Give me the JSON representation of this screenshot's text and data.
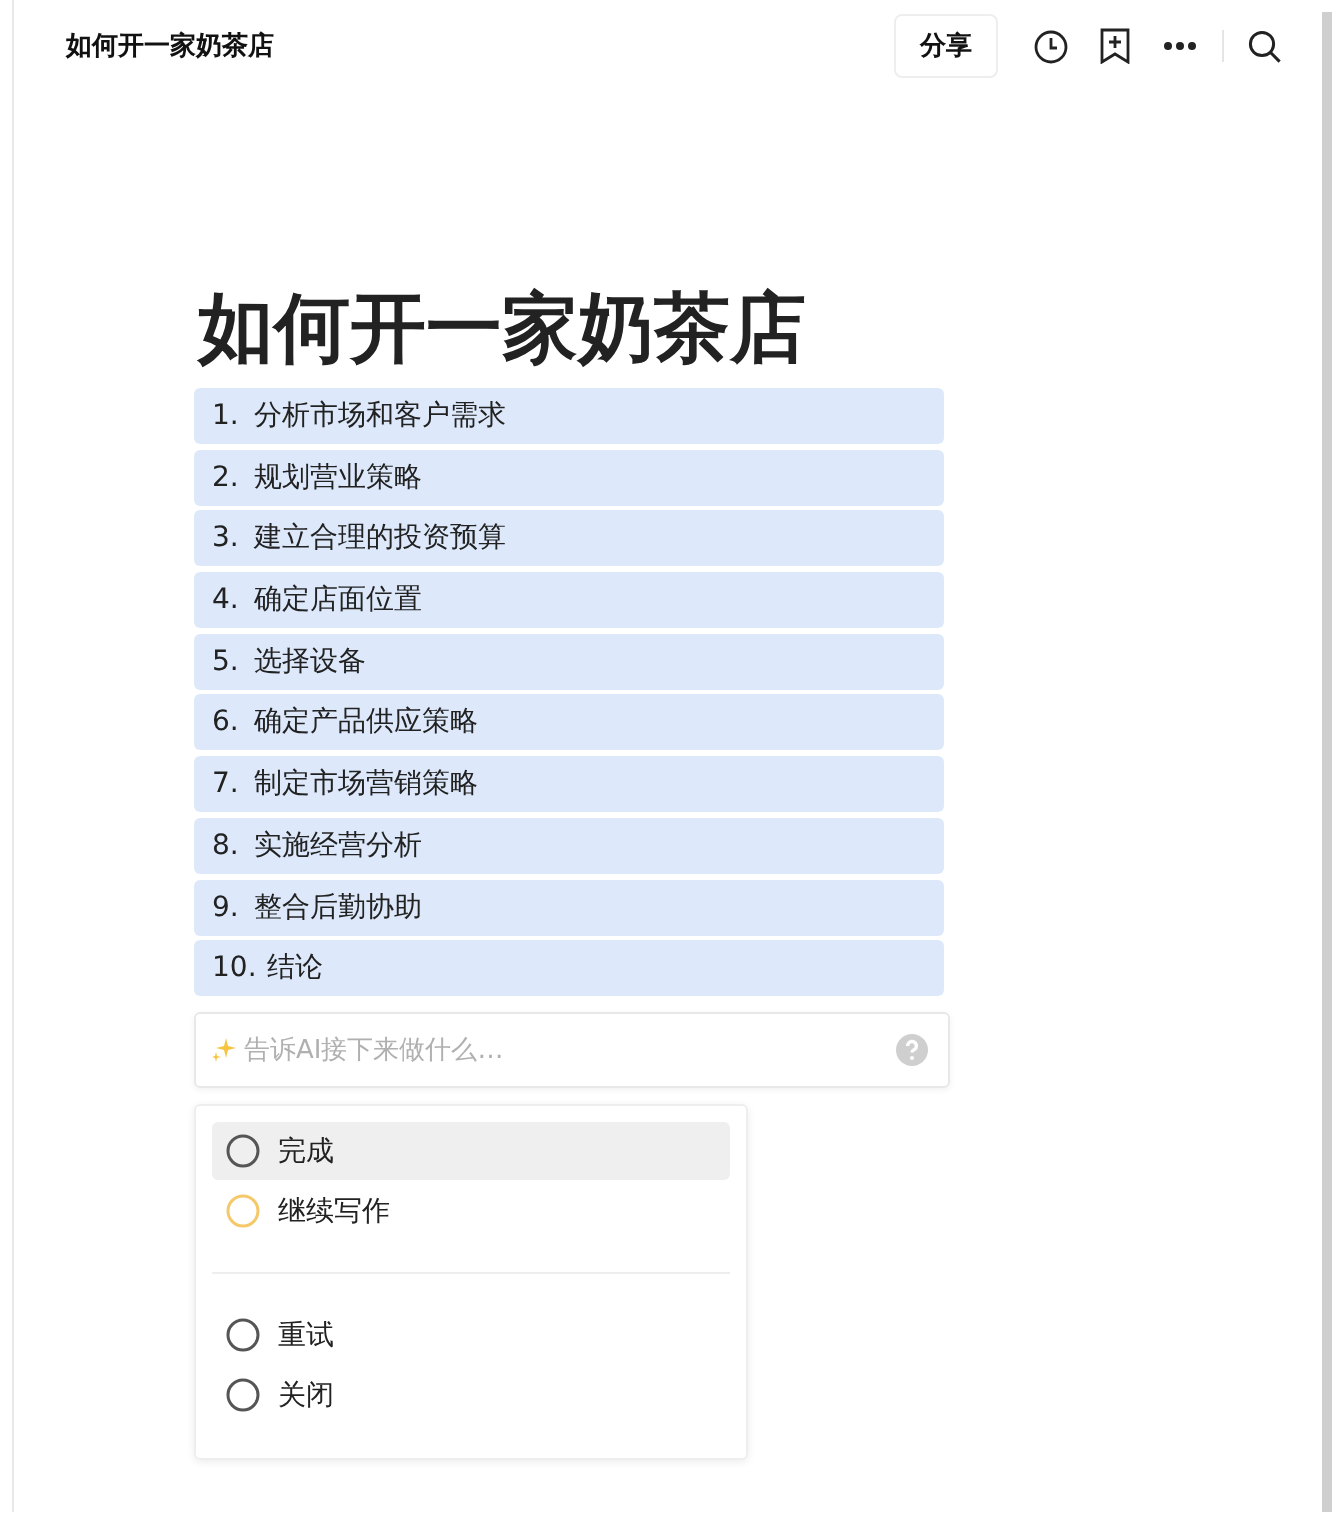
{
  "header": {
    "title": "如何开一家奶茶店",
    "share_button": "分享"
  },
  "document": {
    "title": "如何开一家奶茶店",
    "list": [
      {
        "number": "1.",
        "text": "分析市场和客户需求"
      },
      {
        "number": "2.",
        "text": "规划营业策略"
      },
      {
        "number": "3.",
        "text": "建立合理的投资预算"
      },
      {
        "number": "4.",
        "text": "确定店面位置"
      },
      {
        "number": "5.",
        "text": "选择设备"
      },
      {
        "number": "6.",
        "text": "确定产品供应策略"
      },
      {
        "number": "7.",
        "text": "制定市场营销策略"
      },
      {
        "number": "8.",
        "text": "实施经营分析"
      },
      {
        "number": "9.",
        "text": "整合后勤协助"
      },
      {
        "number": "10.",
        "text": "结论"
      }
    ]
  },
  "ai_prompt": {
    "placeholder": "告诉AI接下来做什么…"
  },
  "menu": {
    "groups": [
      {
        "items": [
          {
            "label": "完成",
            "selected": true,
            "color": "#555555"
          },
          {
            "label": "继续写作",
            "selected": false,
            "color": "#f5c96a"
          }
        ]
      },
      {
        "items": [
          {
            "label": "重试",
            "selected": false,
            "color": "#555555"
          },
          {
            "label": "关闭",
            "selected": false,
            "color": "#555555"
          }
        ]
      }
    ]
  }
}
